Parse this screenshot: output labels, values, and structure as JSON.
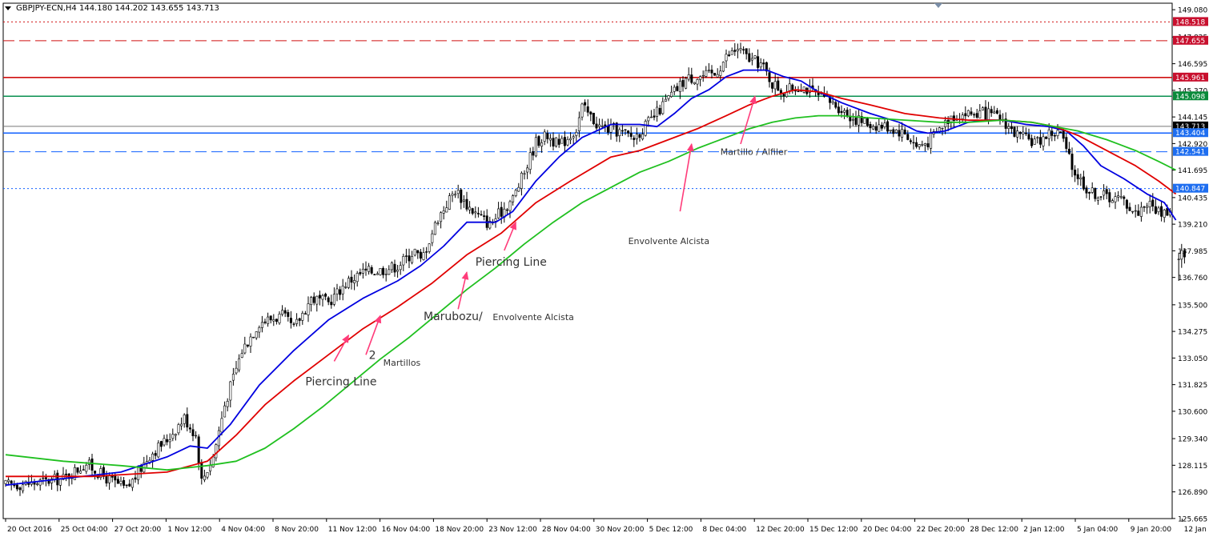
{
  "header": {
    "symbol": "GBPJPY-ECN,H4",
    "ohlc": "144.180 144.202 143.655 143.713"
  },
  "colors": {
    "background": "#ffffff",
    "candle": "#000000",
    "ma_fast": "#0000e0",
    "ma_mid": "#e00000",
    "ma_slow": "#20c020",
    "level_red": "#d01010",
    "level_green": "#0a9050",
    "level_blue": "#1060ff",
    "annotation_arrow": "#ff3c7a",
    "price_tag_red": "#c8102e",
    "price_tag_green": "#0a8a3a",
    "price_tag_blue": "#1e6ef0"
  },
  "chart_data": {
    "type": "candlestick",
    "ylim": [
      125.66,
      149.38
    ],
    "y_ticks": [
      "149.080",
      "147.825",
      "146.595",
      "145.370",
      "144.145",
      "142.920",
      "141.695",
      "140.435",
      "139.210",
      "137.985",
      "136.760",
      "135.500",
      "134.275",
      "133.050",
      "131.825",
      "130.600",
      "129.340",
      "128.115",
      "126.890",
      "125.665"
    ],
    "x_ticks": [
      "20 Oct 2016",
      "25 Oct 04:00",
      "27 Oct 20:00",
      "1 Nov 12:00",
      "4 Nov 04:00",
      "8 Nov 20:00",
      "11 Nov 12:00",
      "16 Nov 04:00",
      "18 Nov 20:00",
      "23 Nov 12:00",
      "28 Nov 04:00",
      "30 Nov 20:00",
      "5 Dec 12:00",
      "8 Dec 04:00",
      "12 Dec 20:00",
      "15 Dec 12:00",
      "20 Dec 04:00",
      "22 Dec 20:00",
      "28 Dec 12:00",
      "2 Jan 12:00",
      "5 Jan 04:00",
      "9 Jan 20:00",
      "12 Jan 12:00"
    ],
    "close_path": [
      [
        0,
        127.2
      ],
      [
        10,
        127.3
      ],
      [
        20,
        127.5
      ],
      [
        28,
        128.2
      ],
      [
        34,
        127.6
      ],
      [
        42,
        127.0
      ],
      [
        50,
        128.6
      ],
      [
        56,
        129.3
      ],
      [
        62,
        130.3
      ],
      [
        66,
        129.5
      ],
      [
        68,
        127.4
      ],
      [
        72,
        128.5
      ],
      [
        76,
        130.9
      ],
      [
        82,
        133.4
      ],
      [
        88,
        134.7
      ],
      [
        96,
        135.0
      ],
      [
        100,
        134.4
      ],
      [
        106,
        135.8
      ],
      [
        112,
        135.6
      ],
      [
        118,
        136.5
      ],
      [
        124,
        137.0
      ],
      [
        130,
        137.1
      ],
      [
        136,
        137.3
      ],
      [
        142,
        138.0
      ],
      [
        144,
        137.5
      ],
      [
        150,
        139.5
      ],
      [
        156,
        140.8
      ],
      [
        160,
        140.1
      ],
      [
        164,
        139.6
      ],
      [
        168,
        139.2
      ],
      [
        172,
        139.8
      ],
      [
        176,
        140.4
      ],
      [
        180,
        141.6
      ],
      [
        184,
        143.0
      ],
      [
        188,
        143.3
      ],
      [
        192,
        142.8
      ],
      [
        198,
        143.6
      ],
      [
        200,
        144.6
      ],
      [
        206,
        143.7
      ],
      [
        212,
        143.5
      ],
      [
        218,
        143.2
      ],
      [
        224,
        144.0
      ],
      [
        230,
        145.0
      ],
      [
        236,
        145.9
      ],
      [
        240,
        146.0
      ],
      [
        246,
        146.1
      ],
      [
        250,
        146.9
      ],
      [
        254,
        147.3
      ],
      [
        258,
        146.8
      ],
      [
        262,
        146.6
      ],
      [
        266,
        145.7
      ],
      [
        270,
        145.3
      ],
      [
        276,
        145.6
      ],
      [
        282,
        145.1
      ],
      [
        288,
        144.7
      ],
      [
        294,
        144.1
      ],
      [
        300,
        143.8
      ],
      [
        306,
        143.7
      ],
      [
        312,
        143.4
      ],
      [
        316,
        142.8
      ],
      [
        320,
        143.0
      ],
      [
        324,
        143.6
      ],
      [
        328,
        144.2
      ],
      [
        334,
        144.3
      ],
      [
        340,
        144.3
      ],
      [
        346,
        144.0
      ],
      [
        350,
        143.4
      ],
      [
        354,
        143.1
      ],
      [
        358,
        143.0
      ],
      [
        362,
        143.4
      ],
      [
        366,
        143.4
      ],
      [
        370,
        141.8
      ],
      [
        376,
        140.7
      ],
      [
        382,
        140.5
      ],
      [
        388,
        140.3
      ],
      [
        392,
        139.7
      ],
      [
        396,
        140.2
      ],
      [
        400,
        139.8
      ],
      [
        404,
        139.8
      ]
    ],
    "gap_candles": [
      [
        407,
        137.6,
        137.9,
        136.6,
        137.6
      ],
      [
        408,
        137.6,
        138.3,
        137.2,
        138.0
      ],
      [
        409,
        138.0,
        138.1,
        137.4,
        137.7
      ]
    ],
    "series": [
      {
        "key": "ma_fast",
        "points": [
          [
            0,
            127.2
          ],
          [
            20,
            127.5
          ],
          [
            40,
            127.8
          ],
          [
            56,
            128.5
          ],
          [
            64,
            129.0
          ],
          [
            70,
            128.9
          ],
          [
            78,
            130.0
          ],
          [
            88,
            131.8
          ],
          [
            100,
            133.4
          ],
          [
            112,
            134.8
          ],
          [
            124,
            135.8
          ],
          [
            136,
            136.6
          ],
          [
            144,
            137.3
          ],
          [
            152,
            138.2
          ],
          [
            160,
            139.3
          ],
          [
            170,
            139.3
          ],
          [
            176,
            139.8
          ],
          [
            184,
            141.2
          ],
          [
            192,
            142.3
          ],
          [
            200,
            143.2
          ],
          [
            210,
            143.8
          ],
          [
            220,
            143.8
          ],
          [
            226,
            143.7
          ],
          [
            232,
            144.3
          ],
          [
            238,
            145.0
          ],
          [
            244,
            145.4
          ],
          [
            250,
            146.0
          ],
          [
            256,
            146.3
          ],
          [
            264,
            146.3
          ],
          [
            270,
            146.0
          ],
          [
            276,
            145.8
          ],
          [
            282,
            145.3
          ],
          [
            290,
            144.8
          ],
          [
            300,
            144.3
          ],
          [
            310,
            143.9
          ],
          [
            316,
            143.5
          ],
          [
            320,
            143.4
          ],
          [
            326,
            143.5
          ],
          [
            334,
            143.9
          ],
          [
            340,
            144.0
          ],
          [
            346,
            144.0
          ],
          [
            354,
            143.8
          ],
          [
            362,
            143.7
          ],
          [
            368,
            143.5
          ],
          [
            374,
            142.8
          ],
          [
            380,
            141.9
          ],
          [
            388,
            141.3
          ],
          [
            396,
            140.6
          ],
          [
            402,
            140.2
          ],
          [
            406,
            139.4
          ]
        ]
      },
      {
        "key": "ma_mid",
        "points": [
          [
            0,
            127.6
          ],
          [
            30,
            127.6
          ],
          [
            56,
            127.8
          ],
          [
            70,
            128.3
          ],
          [
            80,
            129.5
          ],
          [
            90,
            130.9
          ],
          [
            100,
            132.0
          ],
          [
            112,
            133.2
          ],
          [
            124,
            134.4
          ],
          [
            136,
            135.4
          ],
          [
            148,
            136.5
          ],
          [
            160,
            137.8
          ],
          [
            172,
            138.8
          ],
          [
            184,
            140.2
          ],
          [
            196,
            141.2
          ],
          [
            210,
            142.3
          ],
          [
            220,
            142.6
          ],
          [
            230,
            143.1
          ],
          [
            240,
            143.6
          ],
          [
            250,
            144.2
          ],
          [
            258,
            144.7
          ],
          [
            266,
            145.1
          ],
          [
            274,
            145.4
          ],
          [
            282,
            145.3
          ],
          [
            290,
            145.0
          ],
          [
            300,
            144.7
          ],
          [
            312,
            144.3
          ],
          [
            324,
            144.1
          ],
          [
            334,
            144.0
          ],
          [
            346,
            144.0
          ],
          [
            356,
            143.9
          ],
          [
            364,
            143.7
          ],
          [
            372,
            143.3
          ],
          [
            382,
            142.6
          ],
          [
            392,
            141.9
          ],
          [
            400,
            141.2
          ],
          [
            406,
            140.6
          ]
        ]
      },
      {
        "key": "ma_slow",
        "points": [
          [
            0,
            128.6
          ],
          [
            20,
            128.3
          ],
          [
            40,
            128.1
          ],
          [
            56,
            127.9
          ],
          [
            70,
            128.1
          ],
          [
            80,
            128.3
          ],
          [
            90,
            128.9
          ],
          [
            100,
            129.8
          ],
          [
            110,
            130.8
          ],
          [
            120,
            131.9
          ],
          [
            130,
            133.0
          ],
          [
            140,
            134.0
          ],
          [
            150,
            135.1
          ],
          [
            160,
            136.2
          ],
          [
            170,
            137.2
          ],
          [
            180,
            138.3
          ],
          [
            190,
            139.3
          ],
          [
            200,
            140.2
          ],
          [
            210,
            140.9
          ],
          [
            220,
            141.6
          ],
          [
            230,
            142.1
          ],
          [
            240,
            142.7
          ],
          [
            250,
            143.2
          ],
          [
            258,
            143.6
          ],
          [
            266,
            143.9
          ],
          [
            274,
            144.1
          ],
          [
            282,
            144.2
          ],
          [
            290,
            144.2
          ],
          [
            300,
            144.1
          ],
          [
            312,
            144.0
          ],
          [
            324,
            143.9
          ],
          [
            334,
            143.9
          ],
          [
            346,
            144.0
          ],
          [
            356,
            143.9
          ],
          [
            364,
            143.7
          ],
          [
            372,
            143.5
          ],
          [
            382,
            143.1
          ],
          [
            392,
            142.6
          ],
          [
            400,
            142.1
          ],
          [
            406,
            141.7
          ]
        ]
      }
    ],
    "levels": [
      {
        "price": 148.518,
        "style": "dotted",
        "tag": "148.518",
        "color": "#d01010"
      },
      {
        "price": 147.655,
        "style": "dashed",
        "tag": "147.655",
        "color": "#d01010"
      },
      {
        "price": 145.961,
        "style": "solid",
        "tag": "145.961",
        "color": "#d01010"
      },
      {
        "price": 145.098,
        "style": "solid",
        "tag": "145.098",
        "color": "#0a9050"
      },
      {
        "price": 143.713,
        "style": "thin",
        "tag": "143.713",
        "color": "#777777"
      },
      {
        "price": 143.404,
        "style": "solid",
        "tag": "143.404",
        "color": "#1060ff"
      },
      {
        "price": 142.541,
        "style": "dashed",
        "tag": "142.541",
        "color": "#1060ff"
      },
      {
        "price": 140.847,
        "style": "dotted",
        "tag": "140.847",
        "color": "#1060ff"
      }
    ],
    "annotations": [
      {
        "text": "Piercing Line",
        "size": 14,
        "text_at": [
          104,
          131.8
        ],
        "arrow_from": [
          114,
          132.9
        ],
        "arrow_to": [
          119,
          134.1
        ]
      },
      {
        "text": "2",
        "size": 14,
        "text_at": [
          126,
          133.0
        ],
        "arrow_from": [
          125,
          133.2
        ],
        "arrow_to": [
          130,
          135.0
        ]
      },
      {
        "text": "Martillos",
        "size": 11,
        "text_at": [
          131,
          132.7
        ]
      },
      {
        "text": "Piercing Line",
        "size": 14,
        "text_at": [
          163,
          137.3
        ],
        "arrow_from": [
          173,
          138.0
        ],
        "arrow_to": [
          177,
          139.3
        ]
      },
      {
        "text": "Marubozu/",
        "size": 14,
        "text_at": [
          145,
          134.8
        ],
        "arrow_from": [
          157,
          135.3
        ],
        "arrow_to": [
          160,
          137.0
        ]
      },
      {
        "text": "Envolvente Alcista",
        "size": 11,
        "text_at": [
          169,
          134.8
        ]
      },
      {
        "text": "Envolvente Alcista",
        "size": 11,
        "text_at": [
          216,
          138.3
        ],
        "arrow_from": [
          234,
          139.8
        ],
        "arrow_to": [
          238,
          142.9
        ]
      },
      {
        "text": "Martillo / Alfiler",
        "size": 11,
        "text_at": [
          248,
          142.4
        ],
        "arrow_from": [
          255,
          142.9
        ],
        "arrow_to": [
          260,
          145.1
        ]
      }
    ]
  }
}
